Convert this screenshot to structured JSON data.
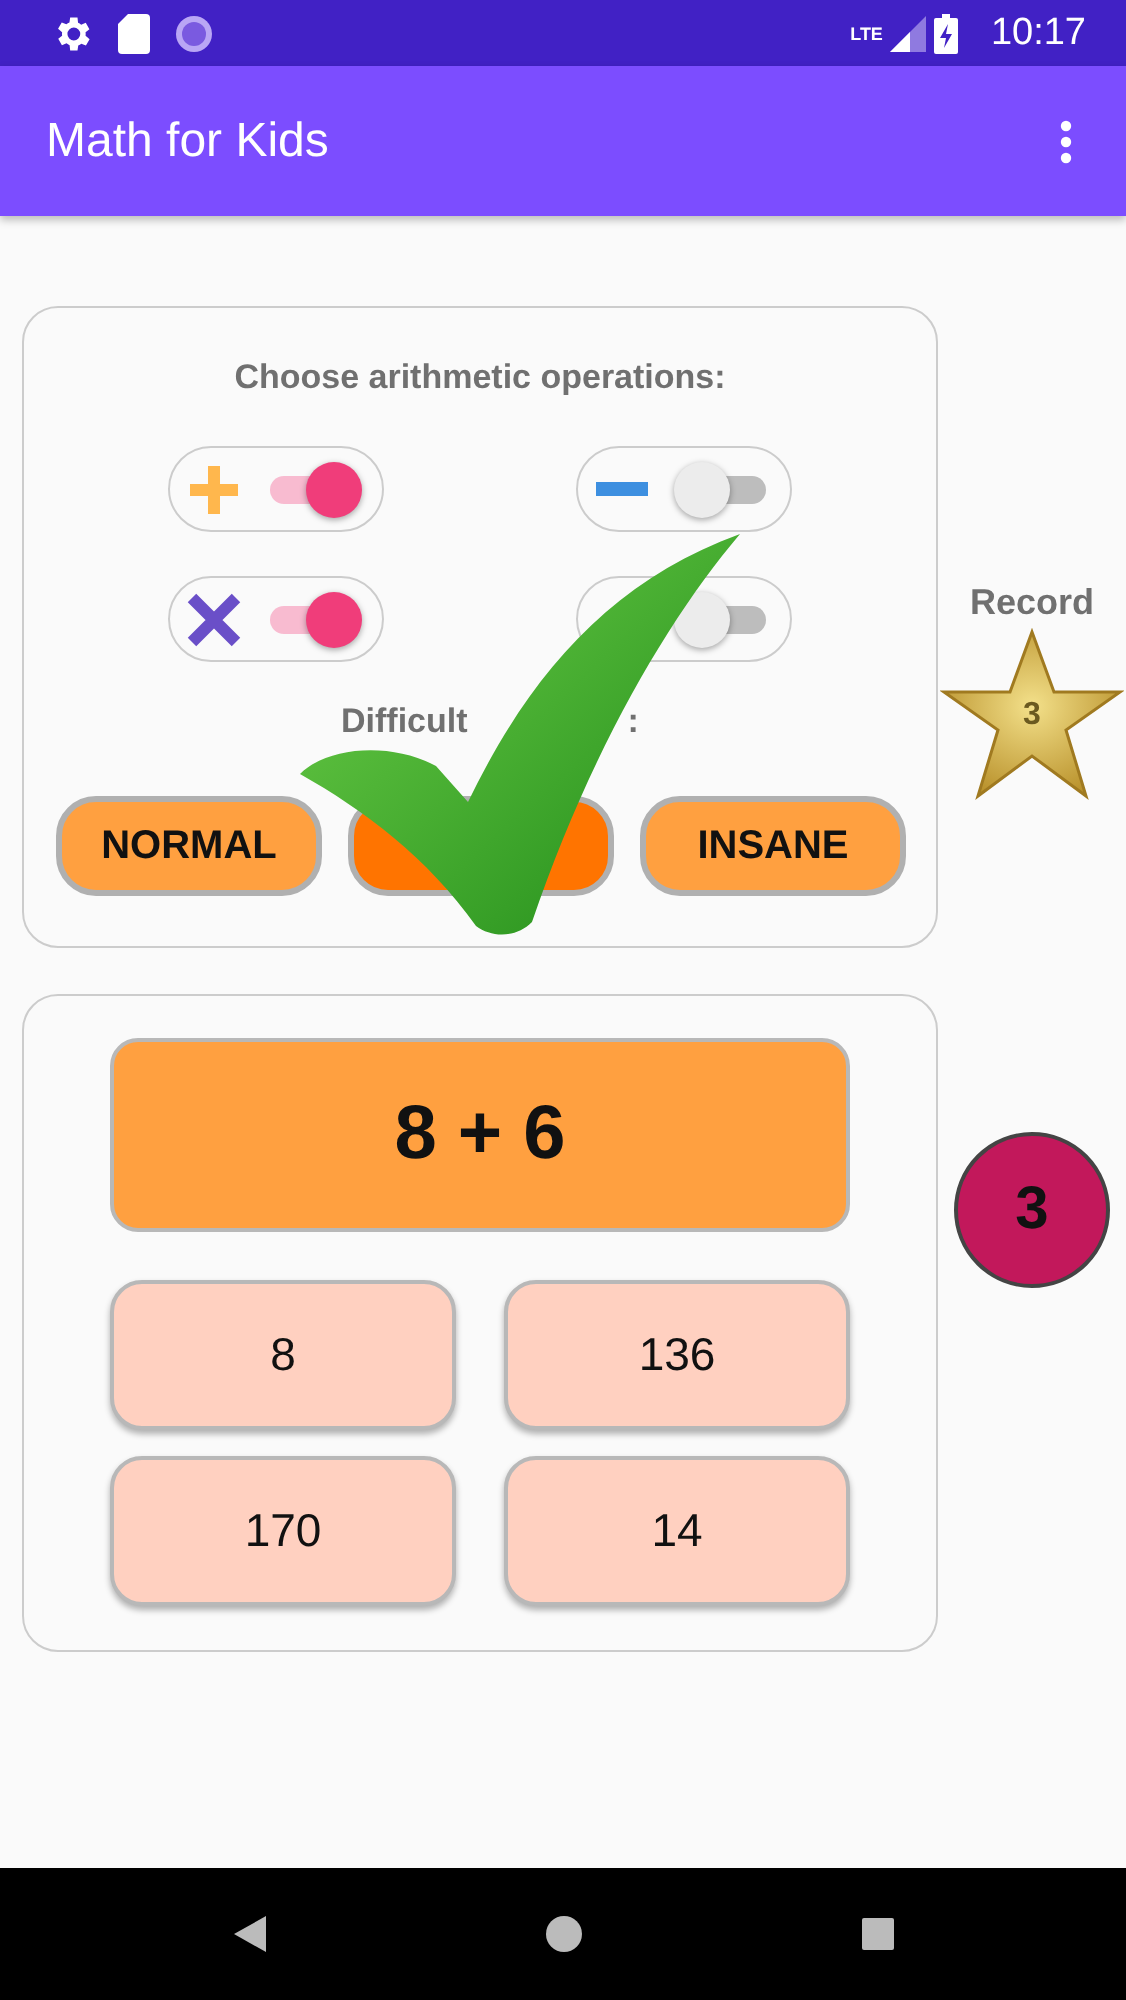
{
  "status_bar": {
    "time": "10:17",
    "network": "LTE"
  },
  "app_bar": {
    "title": "Math for Kids"
  },
  "operations": {
    "title": "Choose arithmetic operations:",
    "switches": [
      {
        "kind": "plus",
        "on": true
      },
      {
        "kind": "minus",
        "on": false
      },
      {
        "kind": "times",
        "on": true
      },
      {
        "on": false
      }
    ],
    "difficulty_label": [
      "Difficult",
      ":"
    ],
    "levels": [
      {
        "label": "NORMAL",
        "selected": false
      },
      {
        "selected": true
      },
      {
        "label": "INSANE",
        "selected": false
      }
    ]
  },
  "record": {
    "label": "Record",
    "value": "3"
  },
  "quiz": {
    "question": "8 + 6",
    "answers": [
      "8",
      "136",
      "170",
      "14"
    ]
  },
  "score": "3"
}
